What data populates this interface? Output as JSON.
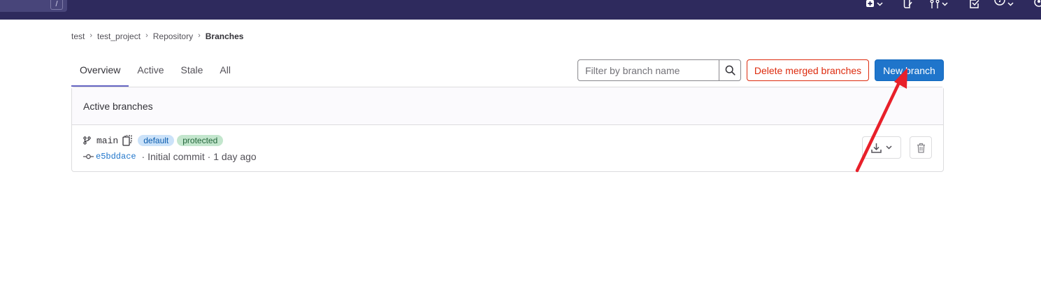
{
  "topbar": {
    "search_shortcut": "/",
    "icons": [
      "plus-icon",
      "issues-icon",
      "merge-request-icon",
      "todo-icon",
      "help-icon",
      "user-avatar-icon"
    ]
  },
  "breadcrumb": {
    "items": [
      "test",
      "test_project",
      "Repository",
      "Branches"
    ]
  },
  "tabs": [
    "Overview",
    "Active",
    "Stale",
    "All"
  ],
  "filter": {
    "placeholder": "Filter by branch name"
  },
  "buttons": {
    "delete_merged": "Delete merged branches",
    "new_branch": "New branch"
  },
  "card": {
    "header": "Active branches",
    "branches": [
      {
        "name": "main",
        "badges": [
          "default",
          "protected"
        ],
        "commit_sha": "e5bddace",
        "commit_message": "Initial commit",
        "time_ago": "1 day ago"
      }
    ]
  },
  "colors": {
    "topbar": "#2e2a5d",
    "primary": "#1f75cb",
    "danger": "#dd2b0e",
    "tab_active_underline": "#6666c4",
    "annotation_arrow": "#e8202a"
  }
}
